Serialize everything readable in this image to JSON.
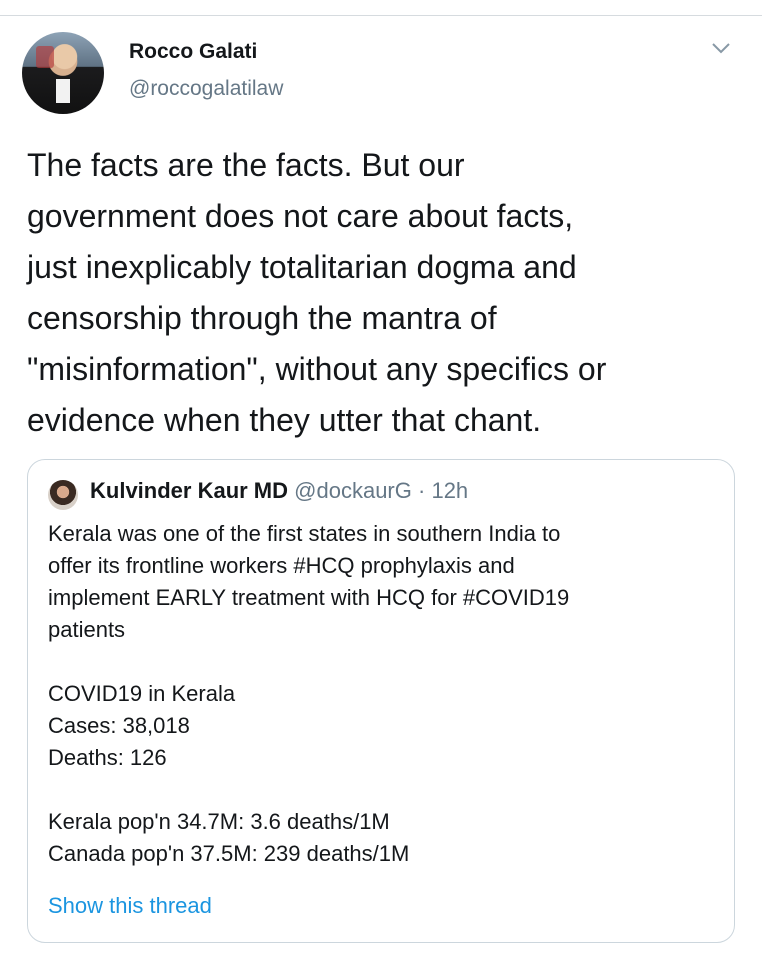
{
  "author": {
    "name": "Rocco Galati",
    "handle": "@roccogalatilaw",
    "avatar_icon": "profile-photo"
  },
  "tweet": {
    "text": "The facts are the facts. But our\ngovernment does not care about facts,\njust inexplicably totalitarian dogma and\ncensorship through the mantra of\n\"misinformation\", without any specifics or\nevidence when they utter that chant."
  },
  "quoted": {
    "name": "Kulvinder Kaur MD",
    "handle": "@dockaurG",
    "separator": "·",
    "time": "12h",
    "text": "Kerala was one of the first states in southern India to\noffer its frontline workers #HCQ prophylaxis and\nimplement EARLY treatment with HCQ for #COVID19\npatients\n\nCOVID19 in Kerala\nCases: 38,018\nDeaths: 126\n\nKerala pop'n 34.7M: 3.6 deaths/1M\nCanada pop'n 37.5M: 239 deaths/1M",
    "thread_link": "Show this thread"
  },
  "colors": {
    "text": "#14171a",
    "secondary": "#657786",
    "link": "#1b95e0",
    "border": "#ccd6dd"
  }
}
